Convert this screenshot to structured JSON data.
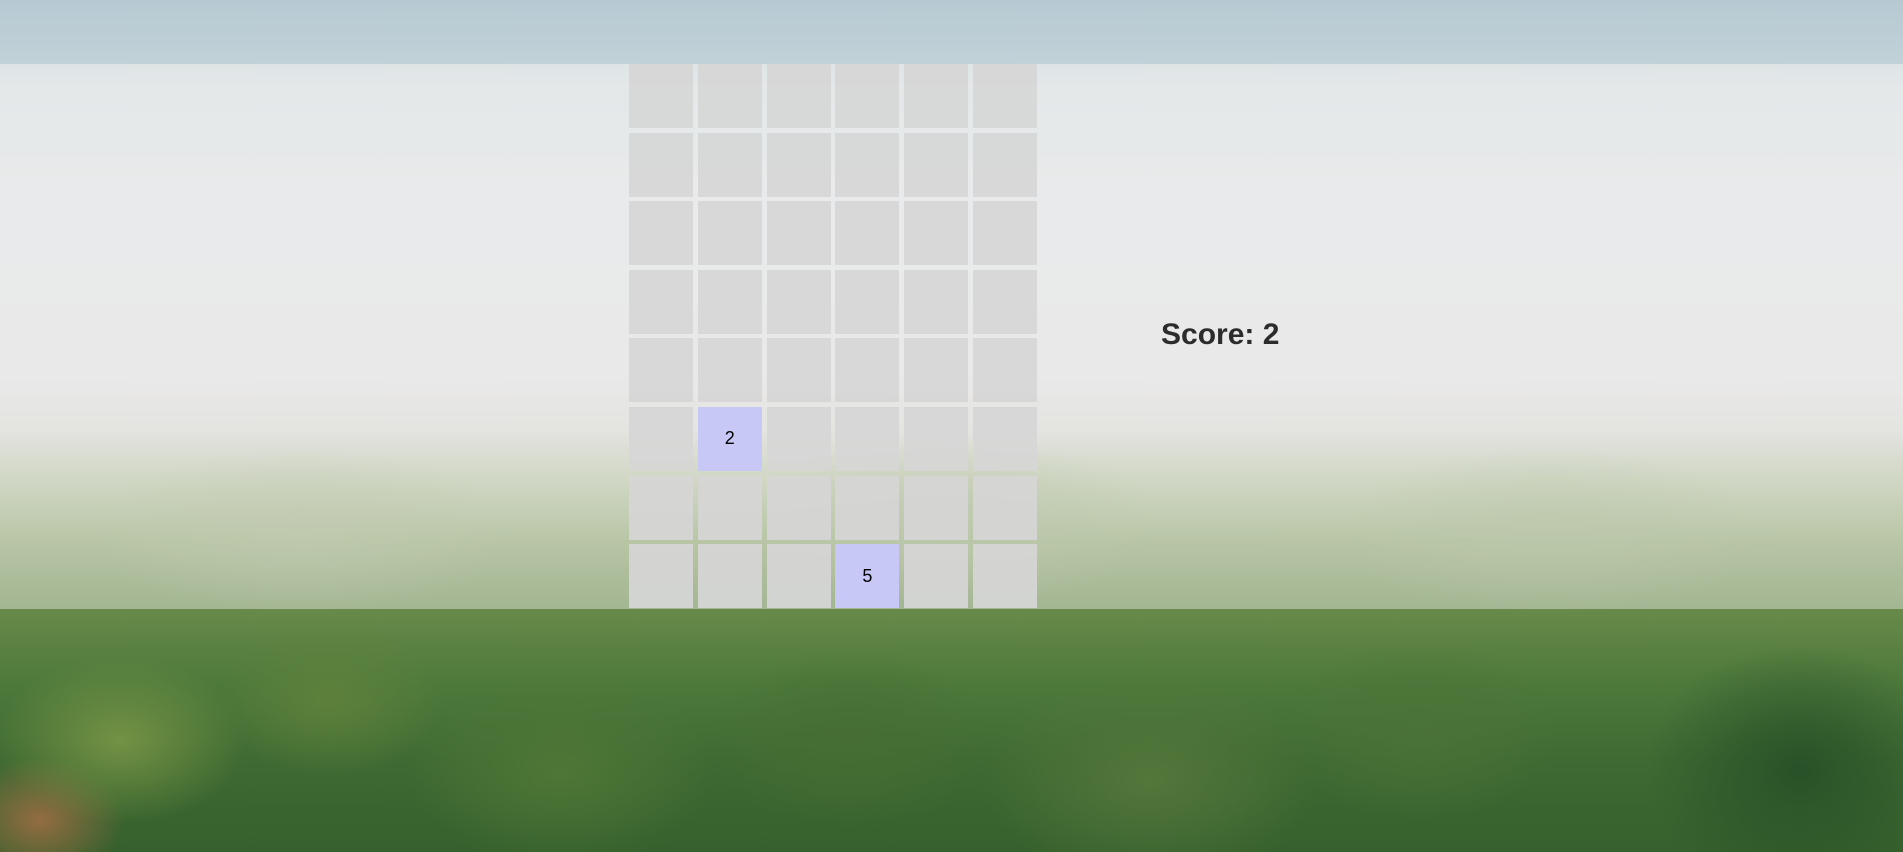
{
  "game": {
    "score_text": "Score: 2",
    "board": {
      "columns": 6,
      "rows": 8,
      "tiles": [
        {
          "row": 6,
          "col": 2,
          "value": "2"
        },
        {
          "row": 8,
          "col": 4,
          "value": "5"
        }
      ],
      "colors": {
        "empty_cell": "#d6d6d6",
        "filled_tile": "#c8c8f6"
      }
    }
  },
  "background": {
    "description_icon": "forest-landscape-image"
  }
}
